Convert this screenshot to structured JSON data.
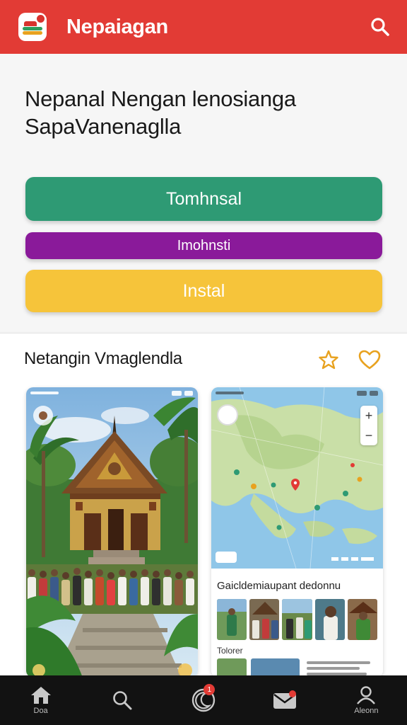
{
  "header": {
    "app_title": "Nepaiagan",
    "logo_icon": "app-logo",
    "search_icon": "search-icon",
    "color": "#e23b35"
  },
  "hero": {
    "title_line1": "Nepanal  Nengan lenosianga",
    "title_line2": "SapaVanenaglla"
  },
  "buttons": [
    {
      "label": "Tomhnsal",
      "color": "#2e9a74"
    },
    {
      "label": "Imohnsti",
      "color": "#8a1a9a"
    },
    {
      "label": "Instal",
      "color": "#f6c43a"
    }
  ],
  "section": {
    "title": "Netangin Vmaglendla",
    "star_icon": "star-icon",
    "heart_icon": "heart-icon",
    "accent": "#e8a21f"
  },
  "cards": {
    "left": {
      "image": "temple-photo"
    },
    "right": {
      "image": "map",
      "zoom_in": "+",
      "zoom_out": "−",
      "info_title": "Gaicldemiaupant  dedonnu",
      "info_subtitle": "Tolorer"
    }
  },
  "bottom_nav": [
    {
      "icon": "home-icon",
      "label": "Doa"
    },
    {
      "icon": "search-icon",
      "label": ""
    },
    {
      "icon": "moon-icon",
      "label": "",
      "badge": "1"
    },
    {
      "icon": "mail-icon",
      "label": ""
    },
    {
      "icon": "profile-icon",
      "label": "Aleonn"
    }
  ]
}
